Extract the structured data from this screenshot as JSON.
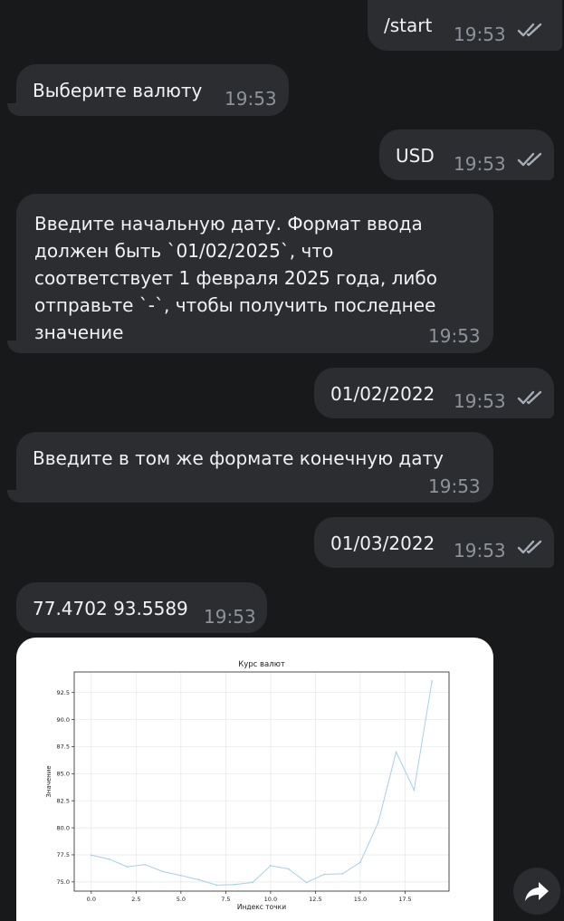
{
  "messages": [
    {
      "text": "/start",
      "time": "19:53"
    },
    {
      "text": "Выберите валюту",
      "time": "19:53"
    },
    {
      "text": "USD",
      "time": "19:53"
    },
    {
      "lines": [
        "Введите начальную дату. Формат ввода",
        "должен быть `01/02/2025`, что",
        "соответствует 1 февраля 2025 года, либо",
        "отправьте `-`, чтобы получить последнее",
        "значение"
      ],
      "time": "19:53"
    },
    {
      "text": "01/02/2022",
      "time": "19:53"
    },
    {
      "text": "Введите в том же формате конечную дату",
      "time": "19:53"
    },
    {
      "text": "01/03/2022",
      "time": "19:53"
    },
    {
      "text": "77.4702 93.5589",
      "time": "19:53"
    }
  ],
  "icons": {
    "read_status": "double-check-icon",
    "forward": "forward-arrow-icon"
  },
  "colors": {
    "background": "#18191b",
    "bubble": "#2b2d31",
    "time": "#8e939b",
    "ticks": "#a7adb6",
    "line": "#aacfe2"
  },
  "chart_data": {
    "type": "line",
    "title": "Курс валют",
    "xlabel": "Индекс точки",
    "ylabel": "Значение",
    "xlim": [
      -0.95,
      19.95
    ],
    "ylim": [
      74.15,
      94.4
    ],
    "xticks": [
      "0.0",
      "2.5",
      "5.0",
      "7.5",
      "10.0",
      "12.5",
      "15.0",
      "17.5"
    ],
    "yticks": [
      "75.0",
      "77.5",
      "80.0",
      "82.5",
      "85.0",
      "87.5",
      "90.0",
      "92.5"
    ],
    "grid": true,
    "x": [
      0,
      1,
      2,
      3,
      4,
      5,
      6,
      7,
      8,
      9,
      10,
      11,
      12,
      13,
      14,
      15,
      16,
      17,
      18,
      19
    ],
    "series": [
      {
        "values": [
          77.47,
          77.1,
          76.4,
          76.6,
          75.95,
          75.6,
          75.2,
          74.7,
          74.75,
          74.95,
          76.5,
          76.2,
          74.95,
          75.7,
          75.75,
          76.8,
          80.5,
          87.0,
          83.5,
          93.56
        ]
      }
    ]
  }
}
